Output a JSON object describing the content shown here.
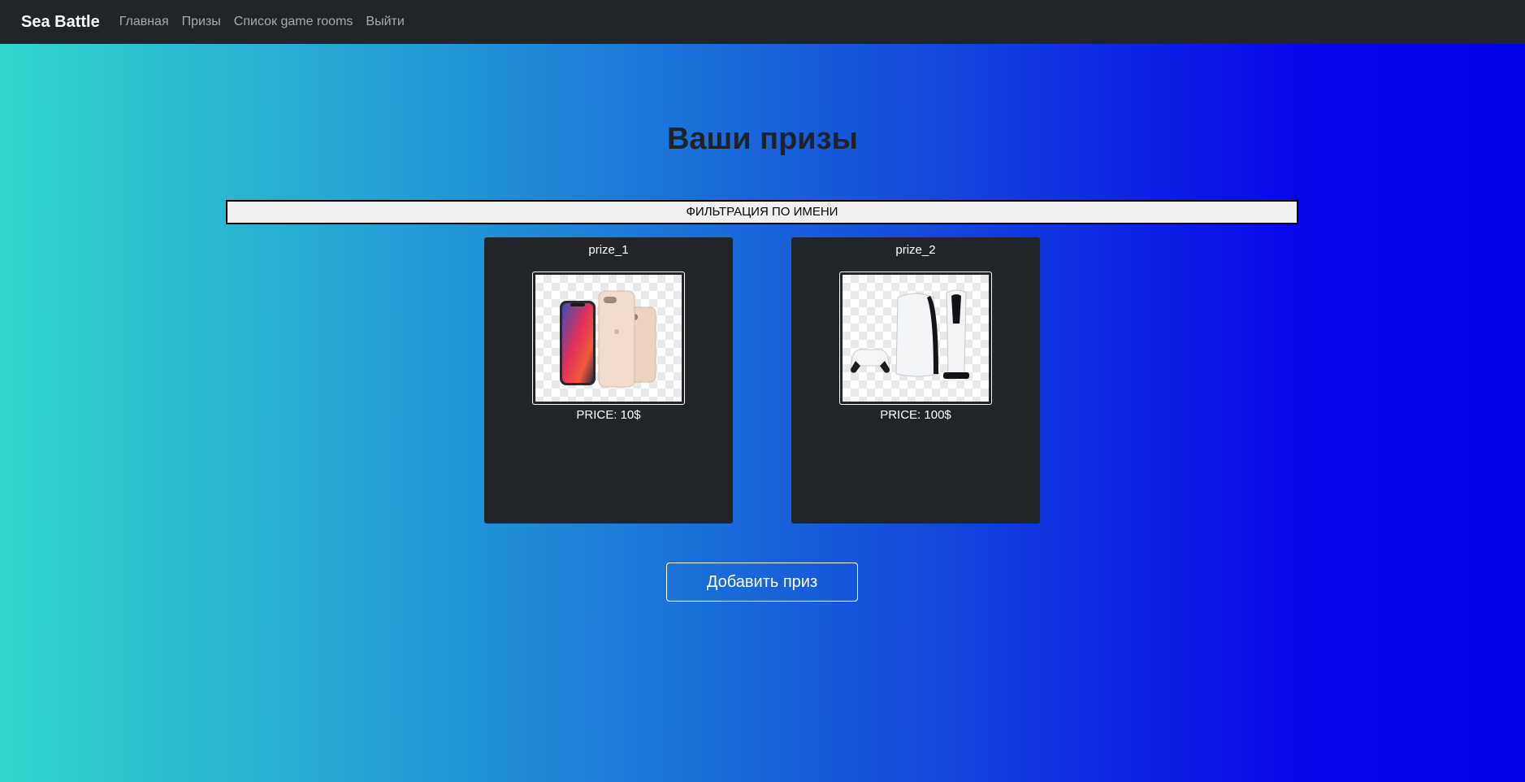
{
  "navbar": {
    "brand": "Sea Battle",
    "links": [
      "Главная",
      "Призы",
      "Список game rooms",
      "Выйти"
    ]
  },
  "page": {
    "title": "Ваши призы",
    "filter_label": "ФИЛЬТРАЦИЯ ПО ИМЕНИ",
    "add_button_label": "Добавить приз"
  },
  "prizes": [
    {
      "name": "prize_1",
      "price": "PRICE: 10$",
      "image": "smartphones-image"
    },
    {
      "name": "prize_2",
      "price": "PRICE: 100$",
      "image": "game-console-image"
    }
  ],
  "colors": {
    "navbar_bg": "#212529",
    "card_bg": "#212529",
    "gradient_start": "#32d6cc",
    "gradient_end": "#0202e8"
  }
}
